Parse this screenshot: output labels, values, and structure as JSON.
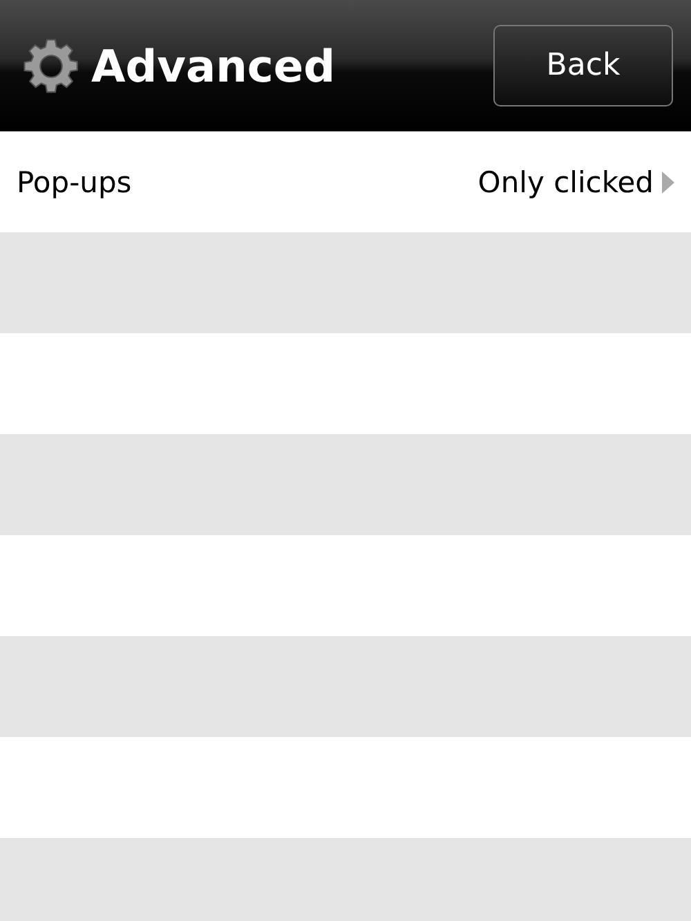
{
  "header": {
    "title": "Advanced",
    "back_button": "Back"
  },
  "settings": [
    {
      "label": "Pop-ups",
      "value": "Only clicked"
    }
  ]
}
